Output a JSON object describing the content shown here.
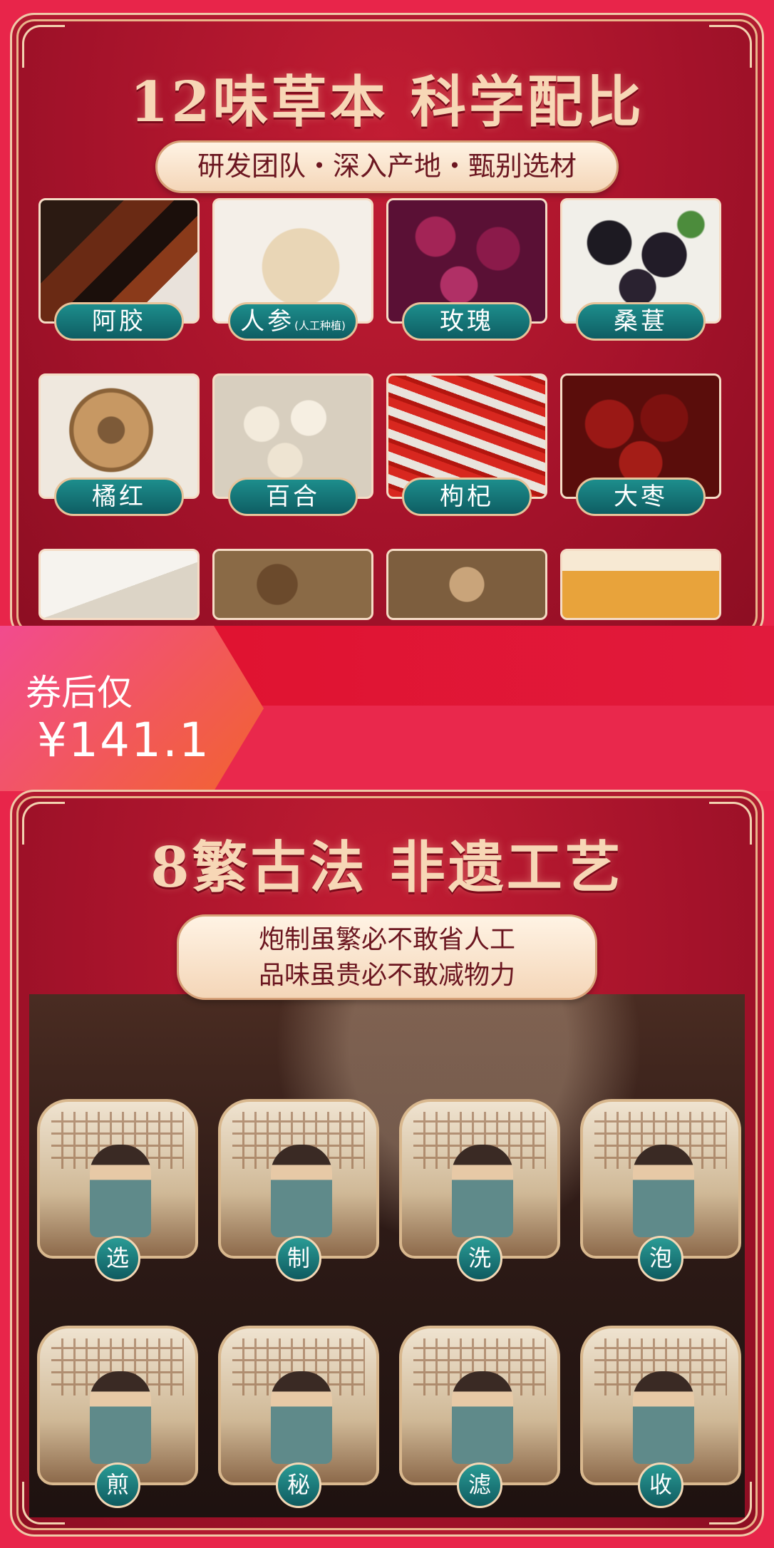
{
  "herbs_section": {
    "title": "12味草本 科学配比",
    "subtitle": "研发团队・深入产地・甄别选材",
    "items": [
      {
        "label": "阿胶",
        "note": ""
      },
      {
        "label": "人参",
        "note": "(人工种植)"
      },
      {
        "label": "玫瑰",
        "note": ""
      },
      {
        "label": "桑葚",
        "note": ""
      },
      {
        "label": "橘红",
        "note": ""
      },
      {
        "label": "百合",
        "note": ""
      },
      {
        "label": "枸杞",
        "note": ""
      },
      {
        "label": "大枣",
        "note": ""
      }
    ]
  },
  "promo": {
    "label": "券后仅",
    "price": "¥141.1"
  },
  "craft_section": {
    "title": "8繁古法 非遗工艺",
    "subtitle_line1": "炮制虽繁必不敢省人工",
    "subtitle_line2": "品味虽贵必不敢减物力",
    "steps": [
      "选",
      "制",
      "洗",
      "泡",
      "煎",
      "秘",
      "滤",
      "收"
    ]
  }
}
